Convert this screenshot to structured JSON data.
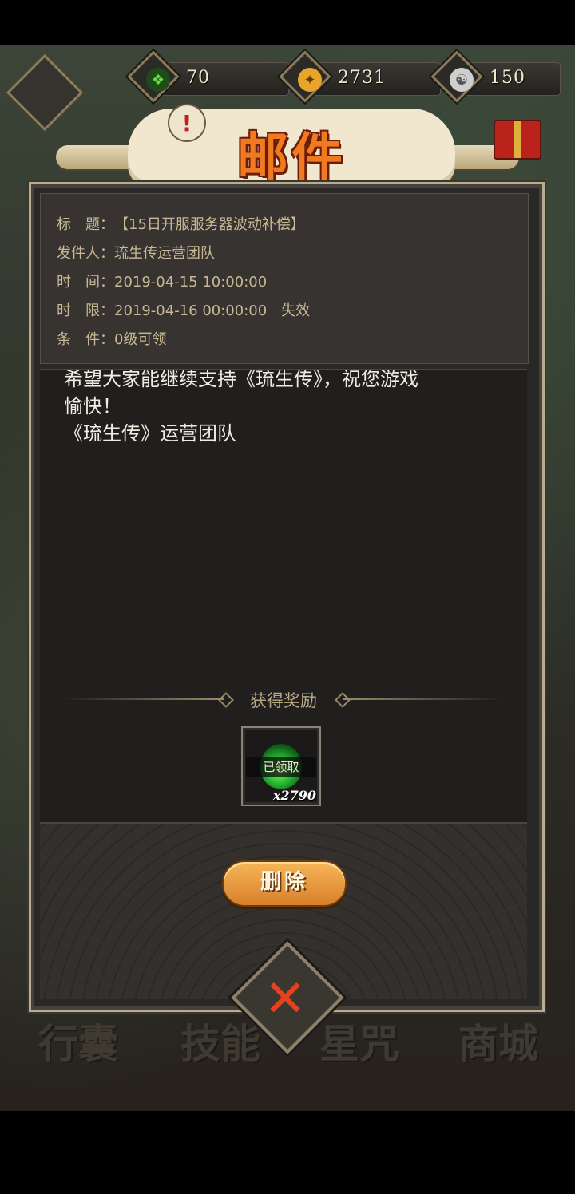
{
  "resources": [
    {
      "icon": "green-flame-icon",
      "value": "70",
      "color": "#47c23a"
    },
    {
      "icon": "gold-coin-icon",
      "value": "2731",
      "color": "#e6a020"
    },
    {
      "icon": "silver-token-icon",
      "value": "150",
      "color": "#c9c9c9"
    }
  ],
  "dialog": {
    "title": "邮件",
    "fields": {
      "subject_label": "标　题：",
      "subject_value": "【15日开服服务器波动补偿】",
      "sender_label": "发件人：",
      "sender_value": "琉生传运营团队",
      "time_label": "时　间：",
      "time_value": "2019-04-15 10:00:00",
      "expire_label": "时　限：",
      "expire_value": "2019-04-16 00:00:00　失效",
      "condition_label": "条　件：",
      "condition_value": "0级可领"
    },
    "body_lines": [
      "希望大家能继续支持《琉生传》，祝您游戏",
      "愉快！",
      "《琉生传》运营团队"
    ],
    "reward_heading": "获得奖励",
    "reward": {
      "icon": "green-flame-icon",
      "status": "已领取",
      "quantity": "x2790"
    },
    "delete_label": "删除"
  },
  "bottom_nav": [
    "行囊",
    "技能",
    "星咒",
    "商城"
  ],
  "colors": {
    "accent": "#f07a20",
    "panel": "#2a2826",
    "text_gold": "#c8b894"
  }
}
